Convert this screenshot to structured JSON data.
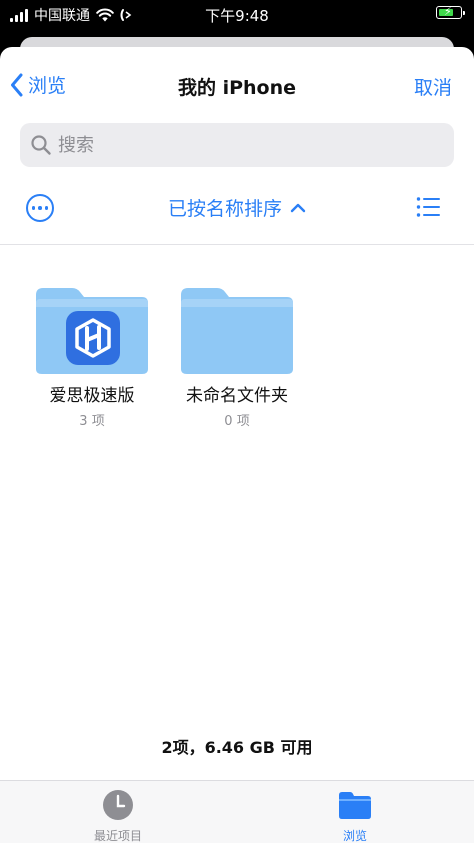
{
  "status_bar": {
    "carrier": "中国联通",
    "time": "下午9:48"
  },
  "nav": {
    "back_label": "浏览",
    "title": "我的 iPhone",
    "cancel_label": "取消"
  },
  "search": {
    "placeholder": "搜索"
  },
  "toolbar": {
    "sort_label": "已按名称排序"
  },
  "folders": [
    {
      "name": "爱思极速版",
      "count": "3 项",
      "has_app_badge": true
    },
    {
      "name": "未命名文件夹",
      "count": "0 项",
      "has_app_badge": false
    }
  ],
  "footer": {
    "storage_text": "2项，6.46 GB 可用"
  },
  "tabbar": {
    "tabs": [
      {
        "label": "最近项目",
        "icon": "clock-icon",
        "active": false
      },
      {
        "label": "浏览",
        "icon": "folder-icon",
        "active": true
      }
    ]
  },
  "colors": {
    "accent": "#2a7ff6",
    "folder": "#8fc8f5",
    "folder_tab": "#a6d3f7",
    "app_icon": "#2f6fe0",
    "inactive_tab": "#8e8e93"
  }
}
